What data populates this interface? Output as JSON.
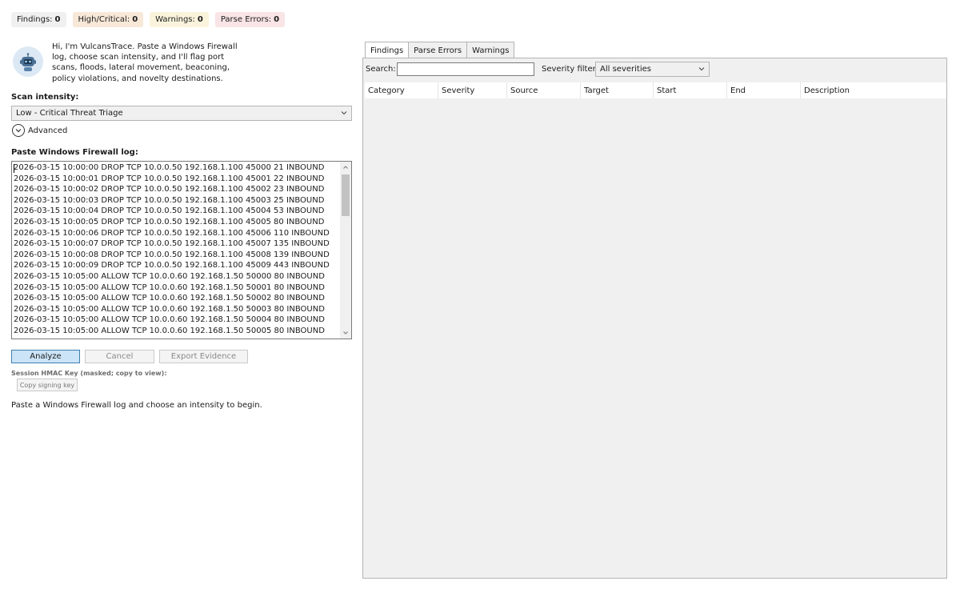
{
  "badges": [
    {
      "label": "Findings:",
      "count": "0",
      "bg": "#f0f0f0"
    },
    {
      "label": "High/Critical:",
      "count": "0",
      "bg": "#f8e8d8"
    },
    {
      "label": "Warnings:",
      "count": "0",
      "bg": "#fbf4dc"
    },
    {
      "label": "Parse Errors:",
      "count": "0",
      "bg": "#f9e4e6"
    }
  ],
  "intro_text": "Hi, I'm VulcansTrace. Paste a Windows Firewall log, choose scan intensity, and I'll flag port scans, floods, lateral movement, beaconing, policy violations, and novelty destinations.",
  "scan_intensity": {
    "label": "Scan intensity:",
    "selected": "Low - Critical Threat Triage"
  },
  "advanced_label": "Advanced",
  "log": {
    "label": "Paste Windows Firewall log:",
    "lines": [
      "2026-03-15 10:00:00 DROP TCP 10.0.0.50 192.168.1.100 45000 21 INBOUND",
      "2026-03-15 10:00:01 DROP TCP 10.0.0.50 192.168.1.100 45001 22 INBOUND",
      "2026-03-15 10:00:02 DROP TCP 10.0.0.50 192.168.1.100 45002 23 INBOUND",
      "2026-03-15 10:00:03 DROP TCP 10.0.0.50 192.168.1.100 45003 25 INBOUND",
      "2026-03-15 10:00:04 DROP TCP 10.0.0.50 192.168.1.100 45004 53 INBOUND",
      "2026-03-15 10:00:05 DROP TCP 10.0.0.50 192.168.1.100 45005 80 INBOUND",
      "2026-03-15 10:00:06 DROP TCP 10.0.0.50 192.168.1.100 45006 110 INBOUND",
      "2026-03-15 10:00:07 DROP TCP 10.0.0.50 192.168.1.100 45007 135 INBOUND",
      "2026-03-15 10:00:08 DROP TCP 10.0.0.50 192.168.1.100 45008 139 INBOUND",
      "2026-03-15 10:00:09 DROP TCP 10.0.0.50 192.168.1.100 45009 443 INBOUND",
      "2026-03-15 10:05:00 ALLOW TCP 10.0.0.60 192.168.1.50 50000 80 INBOUND",
      "2026-03-15 10:05:00 ALLOW TCP 10.0.0.60 192.168.1.50 50001 80 INBOUND",
      "2026-03-15 10:05:00 ALLOW TCP 10.0.0.60 192.168.1.50 50002 80 INBOUND",
      "2026-03-15 10:05:00 ALLOW TCP 10.0.0.60 192.168.1.50 50003 80 INBOUND",
      "2026-03-15 10:05:00 ALLOW TCP 10.0.0.60 192.168.1.50 50004 80 INBOUND",
      "2026-03-15 10:05:00 ALLOW TCP 10.0.0.60 192.168.1.50 50005 80 INBOUND"
    ]
  },
  "buttons": {
    "analyze": "Analyze",
    "cancel": "Cancel",
    "export": "Export Evidence"
  },
  "hmac": {
    "label": "Session HMAC Key (masked; copy to view):",
    "copy_button": "Copy signing key"
  },
  "status_text": "Paste a Windows Firewall log and choose an intensity to begin.",
  "tabs": [
    "Findings",
    "Parse Errors",
    "Warnings"
  ],
  "active_tab": 0,
  "search": {
    "label": "Search:",
    "value": ""
  },
  "severity_filter": {
    "label": "Severity filter:",
    "selected": "All severities"
  },
  "grid_columns": [
    "Category",
    "Severity",
    "Source",
    "Target",
    "Start",
    "End",
    "Description"
  ],
  "colors": {
    "primary_button_bg": "#cce4f7",
    "primary_button_border": "#3c7fb1"
  }
}
